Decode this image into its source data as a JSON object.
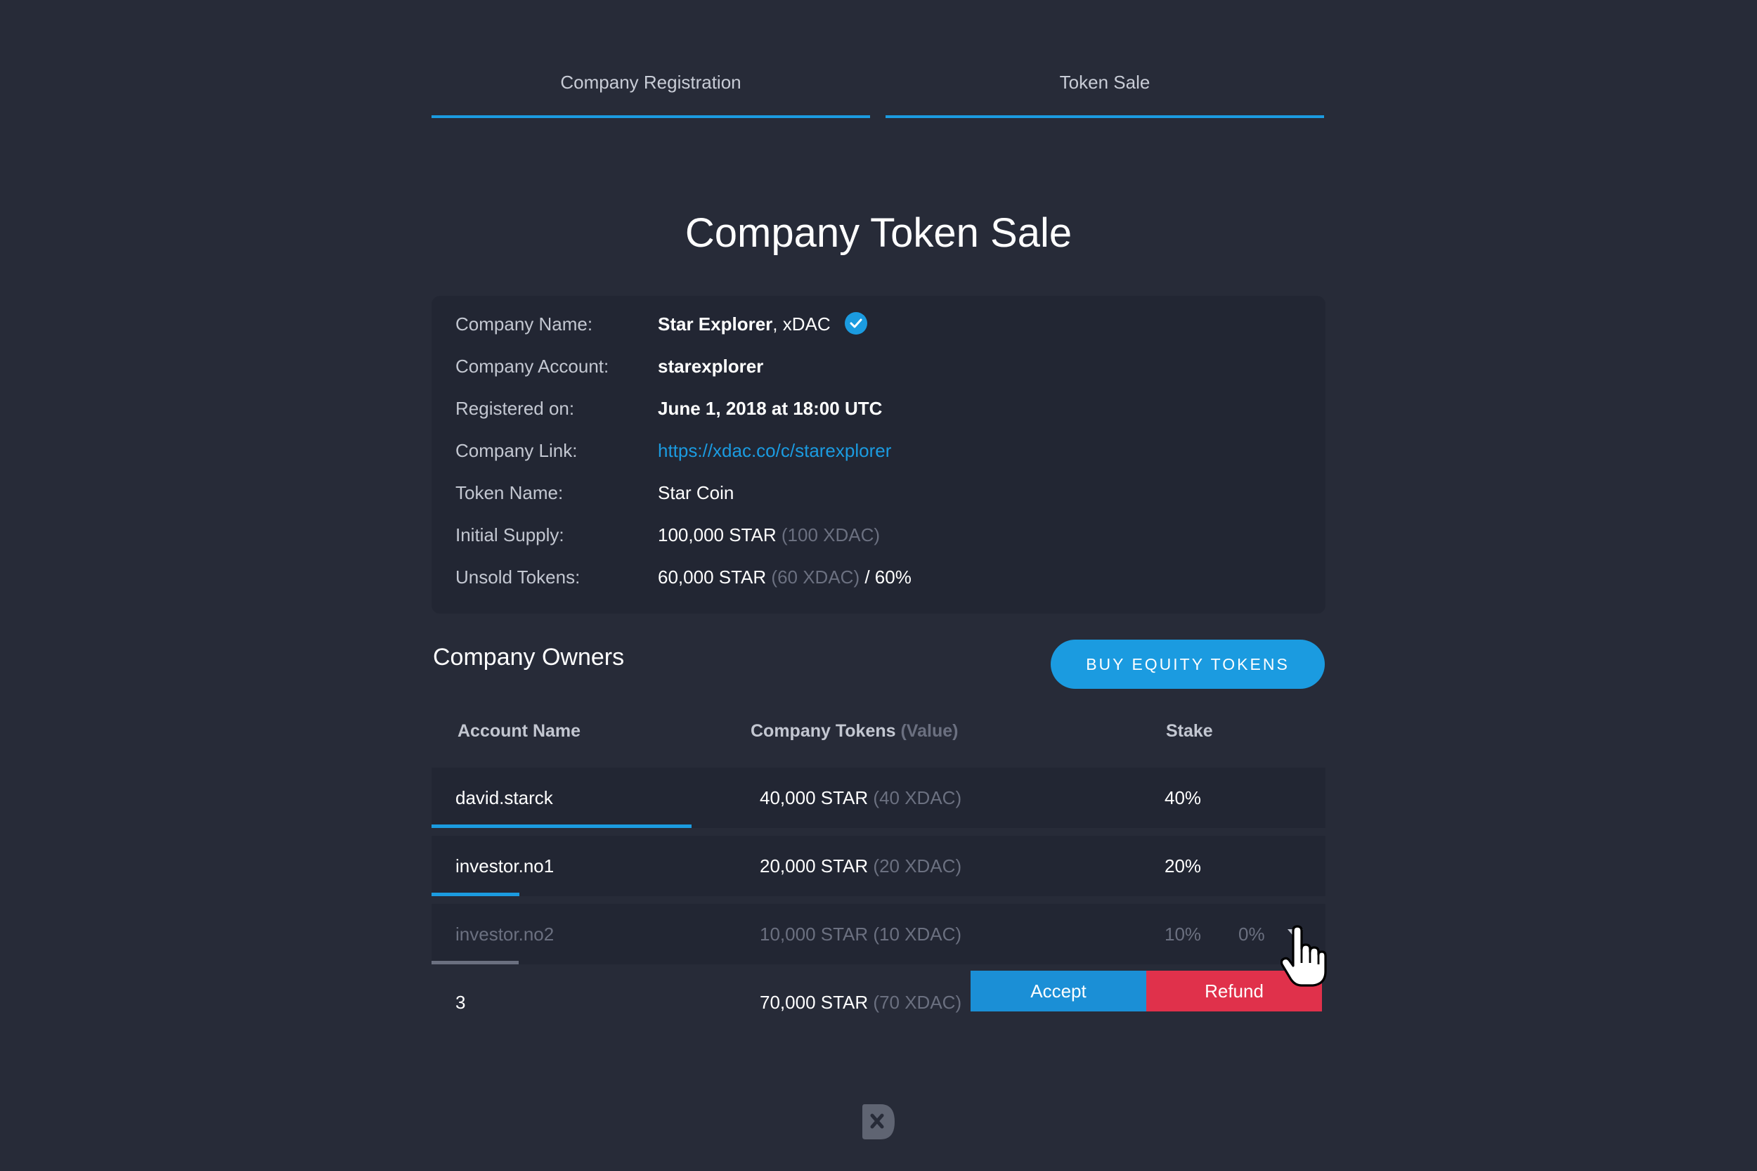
{
  "tabs": {
    "registration": "Company Registration",
    "token_sale": "Token Sale"
  },
  "page_title": "Company Token Sale",
  "info": {
    "company_name": {
      "label": "Company Name:",
      "name_bold": "Star Explorer",
      "suffix": ", xDAC"
    },
    "company_account": {
      "label": "Company Account:",
      "value": "starexplorer"
    },
    "registered_on": {
      "label": "Registered on:",
      "value": "June 1, 2018 at 18:00 UTC"
    },
    "company_link": {
      "label": "Company Link:",
      "value": "https://xdac.co/c/starexplorer"
    },
    "token_name": {
      "label": "Token Name:",
      "value": "Star Coin"
    },
    "initial_supply": {
      "label": "Initial Supply:",
      "value": "100,000 STAR",
      "sub": "(100 XDAC)"
    },
    "unsold_tokens": {
      "label": "Unsold Tokens:",
      "value": "60,000 STAR",
      "sub": "(60 XDAC)",
      "pct": "/ 60%"
    }
  },
  "owners": {
    "title": "Company Owners",
    "buy_button": "BUY EQUITY TOKENS",
    "headers": {
      "account": "Account Name",
      "tokens": "Company Tokens",
      "tokens_sub": "(Value)",
      "stake": "Stake"
    },
    "rows": [
      {
        "name": "david.starck",
        "tokens": "40,000 STAR",
        "value": "(40 XDAC)",
        "stake": "40%",
        "stake_fraction": 0.4
      },
      {
        "name": "investor.no1",
        "tokens": "20,000 STAR",
        "value": "(20 XDAC)",
        "stake": "20%",
        "stake_fraction": 0.2
      },
      {
        "name": "investor.no2",
        "tokens": "10,000 STAR (10 XDAC)",
        "stake": "10%",
        "extra": "0%",
        "stake_fraction": 0.2
      },
      {
        "name": "3",
        "tokens": "70,000 STAR",
        "value": "(70 XDAC)"
      }
    ],
    "accept_button": "Accept",
    "refund_button": "Refund"
  },
  "colors": {
    "background": "#272b38",
    "card": "#222633",
    "accent": "#1b9be0",
    "danger": "#e0314b",
    "muted": "#6b7080"
  }
}
